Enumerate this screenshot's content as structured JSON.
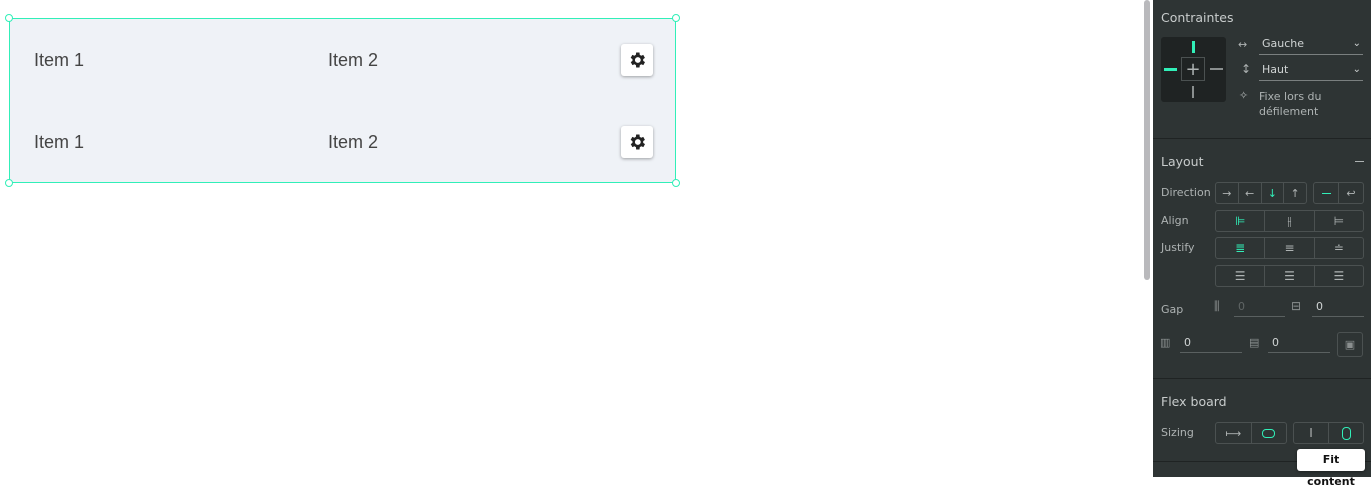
{
  "board": {
    "rows": [
      {
        "item1": "Item 1",
        "item2": "Item 2"
      },
      {
        "item1": "Item 1",
        "item2": "Item 2"
      }
    ]
  },
  "panel": {
    "constraints": {
      "title": "Contraintes",
      "horizontal": "Gauche",
      "vertical": "Haut",
      "fixed_label": "Fixe lors du défilement"
    },
    "layout": {
      "title": "Layout",
      "direction_label": "Direction",
      "align_label": "Align",
      "justify_label": "Justify",
      "gap_label": "Gap",
      "gap_row_placeholder": "0",
      "gap_column_value": "0",
      "padding_vertical": "0",
      "padding_horizontal": "0"
    },
    "flex_board": {
      "title": "Flex board",
      "sizing_label": "Sizing",
      "tooltip": "Fit content"
    }
  },
  "colors": {
    "accent": "#31efb8",
    "panel_bg": "#2e3434",
    "board_bg": "#eff2f7"
  }
}
